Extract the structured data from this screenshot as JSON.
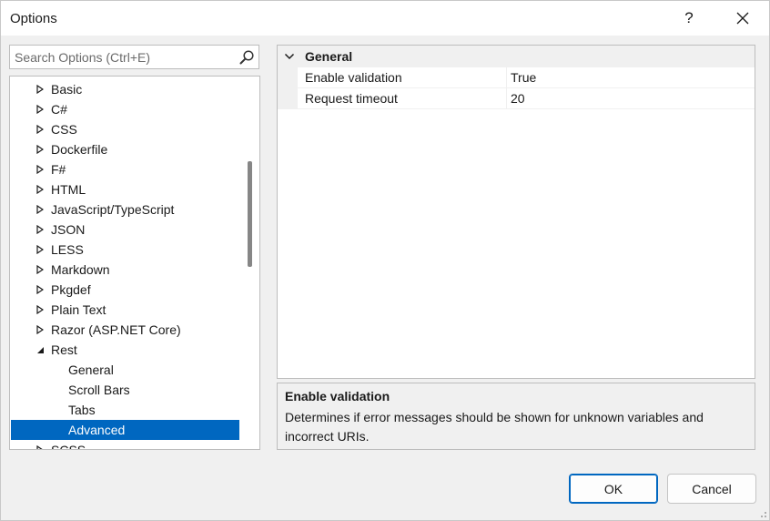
{
  "window": {
    "title": "Options",
    "help_glyph": "?",
    "close_glyph": "✕"
  },
  "search": {
    "placeholder": "Search Options (Ctrl+E)",
    "icon": "search-icon"
  },
  "tree": {
    "items": [
      {
        "label": "Basic",
        "level": 0,
        "expander": "collapsed"
      },
      {
        "label": "C#",
        "level": 0,
        "expander": "collapsed"
      },
      {
        "label": "CSS",
        "level": 0,
        "expander": "collapsed"
      },
      {
        "label": "Dockerfile",
        "level": 0,
        "expander": "collapsed"
      },
      {
        "label": "F#",
        "level": 0,
        "expander": "collapsed"
      },
      {
        "label": "HTML",
        "level": 0,
        "expander": "collapsed"
      },
      {
        "label": "JavaScript/TypeScript",
        "level": 0,
        "expander": "collapsed"
      },
      {
        "label": "JSON",
        "level": 0,
        "expander": "collapsed"
      },
      {
        "label": "LESS",
        "level": 0,
        "expander": "collapsed"
      },
      {
        "label": "Markdown",
        "level": 0,
        "expander": "collapsed"
      },
      {
        "label": "Pkgdef",
        "level": 0,
        "expander": "collapsed"
      },
      {
        "label": "Plain Text",
        "level": 0,
        "expander": "collapsed"
      },
      {
        "label": "Razor (ASP.NET Core)",
        "level": 0,
        "expander": "collapsed"
      },
      {
        "label": "Rest",
        "level": 0,
        "expander": "expanded"
      },
      {
        "label": "General",
        "level": 1,
        "expander": "none"
      },
      {
        "label": "Scroll Bars",
        "level": 1,
        "expander": "none"
      },
      {
        "label": "Tabs",
        "level": 1,
        "expander": "none"
      },
      {
        "label": "Advanced",
        "level": 1,
        "expander": "none",
        "selected": true
      },
      {
        "label": "SCSS",
        "level": 0,
        "expander": "collapsed"
      }
    ]
  },
  "properties": {
    "category": "General",
    "rows": [
      {
        "name": "Enable validation",
        "value": "True"
      },
      {
        "name": "Request timeout",
        "value": "20"
      }
    ]
  },
  "description": {
    "title": "Enable validation",
    "text": "Determines if error messages should be shown for unknown variables and incorrect URIs."
  },
  "buttons": {
    "ok": "OK",
    "cancel": "Cancel"
  },
  "colors": {
    "selection": "#0067c0",
    "window_bg": "#f0f0f0"
  }
}
